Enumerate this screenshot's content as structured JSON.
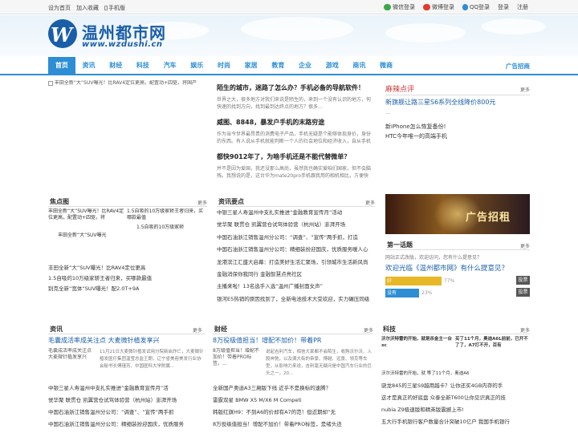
{
  "topbar": {
    "left": [
      "设为首页",
      "加入收藏",
      "手机版"
    ],
    "right": [
      {
        "label": "微信登录",
        "icon": "wechat-icon",
        "color": "#3aa94a"
      },
      {
        "label": "微博登录",
        "icon": "weibo-icon",
        "color": "#e23a2d"
      },
      {
        "label": "QQ登录",
        "icon": "qq-icon",
        "color": "#2d8ed6"
      }
    ],
    "login": "登录",
    "register": "注册"
  },
  "logo": {
    "title": "温州都市网",
    "url": "www.wzdushi.cn",
    "mark": "W"
  },
  "nav": {
    "items": [
      "首页",
      "资讯",
      "财经",
      "科技",
      "汽车",
      "娱乐",
      "时尚",
      "家居",
      "教育",
      "企业",
      "游戏",
      "商讯",
      "微商"
    ],
    "ad": "广告招商",
    "accent": "#2d8ed6"
  },
  "top": {
    "main_img": "丰田全新“大”SUV曝光！比RAV4定位更高，配置动+四驱，将国产",
    "stories": [
      {
        "title": "陌生的城市，迷路了怎么办？手机必备的导航软件！",
        "desc": "世界之大，很多地方对我们来说是陌生的，来到一个没有认识的地方，何快速的找到方向，找到最到达终点的地方？很多..."
      },
      {
        "title": "威图、8848，暴发户手机的末路穷途",
        "desc": "作为当今世界最昂贵的消费电子产品，手机无疑是个能够体现身价，身份的东西。有人说从手机就能判断一个人的社会地位和经济收入，自从手机也进入了名贵的奢侈品时代，于是就有..."
      },
      {
        "title": "都快9012年了，为啥手机还是不能代替微单？",
        "desc": "并不是因为爱国，我还没那么高尚，虽然我也确实爱咱们国家，但不会脑残。我想说的是，这台华为mate20pro手机跟我用的相机相比，方便快捷，还有各种各样的优点。但是在拍摄质量..."
      }
    ],
    "comment": {
      "title": "麻辣点评",
      "more": "更多",
      "headline": "新旗舰让路三星S6系列全线降价800元",
      "extra": "...",
      "items": [
        "新iPhone怎么恢复备份!",
        "HTC今年唯一的高端手机"
      ]
    }
  },
  "focus": {
    "title": "焦点图",
    "more": "更多",
    "cards": [
      "丰田全新“大”SUV曝光！比RAV4定位更高，配置动+四驱，将",
      "1.5自吸的10万级家轿王者归来，买哪款最值"
    ],
    "bottom_caption": [
      "丰田全新“大”SUV曝光",
      "1.5自吸的10万级家轿"
    ],
    "list": [
      "丰田全新“大”SUV曝光！比RAV4定位更高",
      "1.5自吸的10万级家轿王者归来，买哪款最值",
      "别克全新“宽体”SUV曝光！配2.0T+9A"
    ]
  },
  "news": {
    "title": "资讯要点",
    "more": "更多",
    "items": [
      "中银三星人寿温州中支扎实推进“金融教育宣传月”活动",
      "觉华聚 联贯仓 凯翼营仓试驾体验营（杭州站）澎湃开场",
      "中国石油浙江销售温州分公司：“调查”、“宣传”两手抓，打造",
      "中国石油浙江销售温州分公司：精细装扮迎国庆，优质服务暖人心",
      "龙港滨江汇盛大启幕：打造美好生活汇聚场，引领城市生活新风尚",
      "金融消保你我同行 金融智慧点亮社区",
      "主播来啦！13名选手入选“温州广播封面女声”",
      "银河E5热销的原因找到了，全新电池技术大受欢迎，实力碾压同级"
    ]
  },
  "ad_banner": {
    "text": "广告招租"
  },
  "vote": {
    "title": "第一话题",
    "more": "更多",
    "subtitle": "网站正式改版，欢迎访问，您有什么提意见？",
    "question": "欢迎光临《温州都市网》有什么提意见？",
    "options": [
      {
        "label": "好",
        "pct": "77%",
        "value": 77,
        "color": "#e8b726",
        "btn": "投票"
      },
      {
        "label": "没有",
        "pct": "23%",
        "value": 23,
        "color": "#2d8ed6",
        "btn": "投票"
      }
    ]
  },
  "col_news": {
    "title": "资讯",
    "more": "更多",
    "headline": "毛囊成活率成关注点 大麦微针植发享兴",
    "img_caption": "毛囊成活率成关注点 大麦微针植发享兴",
    "desc": "11月21日大麦微针植发试用分院新启炸亡，大麦微针植发医疗集团温莹总监王朗，辽宁省美容美发行业协会秘书长傅瑾芳、中国医科大学附属...",
    "list": [
      "中银三星人寿温州中支扎实推进“金融教育宣传月”活",
      "觉华聚 联贯仓 凯翼营仓试驾体验营（杭州站）澎湃开场",
      "中国石油浙江销售温州分公司：“调查”、“宣传”两手抓",
      "中国石油浙江销售温州分公司：精细装扮迎国庆，优质服务"
    ]
  },
  "col_fin": {
    "title": "财经",
    "more": "更多",
    "headline": "8万役级值担当！增配不加价！带着PR",
    "img_caption": "8万级值担当！增配不加价！带着PRO标签，...",
    "desc": "说起吉利汽车，相信大家都不会陌生，收购沃尔沃、入股奔驰，以及满大街的帝豪、博越、远景、领克等车型，从影响力来说，吉利毫无疑问是中国汽车行业的巨头之一，20...",
    "list": [
      "全新国产奥迪A3三厢版下线 近乎不是换标的速腾？",
      "雷霆双星 BMW X5 M/X6 M Competi",
      "韩版红旗H9：不到A6的价却有A7的范！但近期却“无",
      "8万役级值担当！增配不加价！带着PRO标签，是绪头还"
    ]
  },
  "col_tech": {
    "title": "科技",
    "more": "更多",
    "cards": [
      "沃尔沃特雷的开始，就是杀金主一台xc",
      "买了11个月，奥迪A6L前前，已开不了了，A7打不开，百有"
    ],
    "card_tail": "沃尔沃特雷的开始，就  等了11个月，奥迪A6",
    "list": [
      "骁龙845的三星S9越用越卡？让你还买4GB内存的手",
      "这才是真正的好底盘 众泰全新T600让你见识真正的技",
      "nubia Z9极速版和精英版震撼上市!",
      "五大行手机银行客户数量合计突破10亿户 我国手机银行"
    ]
  }
}
